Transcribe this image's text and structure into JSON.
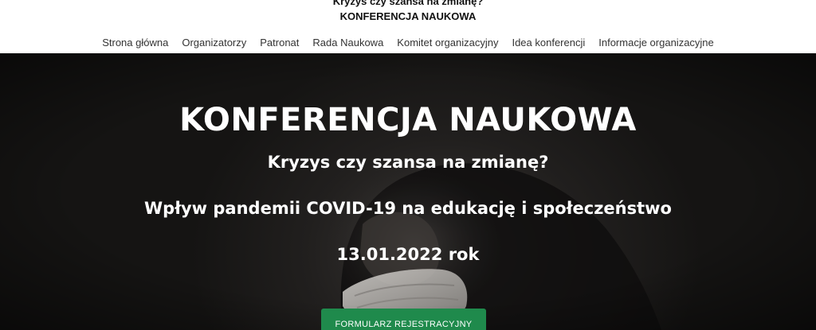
{
  "header": {
    "title": "Kryzys czy szansa na zmianę?",
    "subtitle": "KONFERENCJA NAUKOWA"
  },
  "nav": {
    "items": [
      {
        "label": "Strona główna"
      },
      {
        "label": "Organizatorzy"
      },
      {
        "label": "Patronat"
      },
      {
        "label": "Rada Naukowa"
      },
      {
        "label": "Komitet organizacyjny"
      },
      {
        "label": "Idea konferencji"
      },
      {
        "label": "Informacje organizacyjne"
      }
    ]
  },
  "hero": {
    "title": "KONFERENCJA NAUKOWA",
    "line1": "Kryzys czy szansa na zmianę?",
    "line2": "Wpływ pandemii COVID-19 na edukację i społeczeństwo",
    "date": "13.01.2022 rok",
    "button_label": "FORMULARZ REJESTRACYJNY"
  },
  "colors": {
    "button": "#1f8a4c",
    "hero_background": "#1c1b1a",
    "text_light": "#ffffff"
  }
}
